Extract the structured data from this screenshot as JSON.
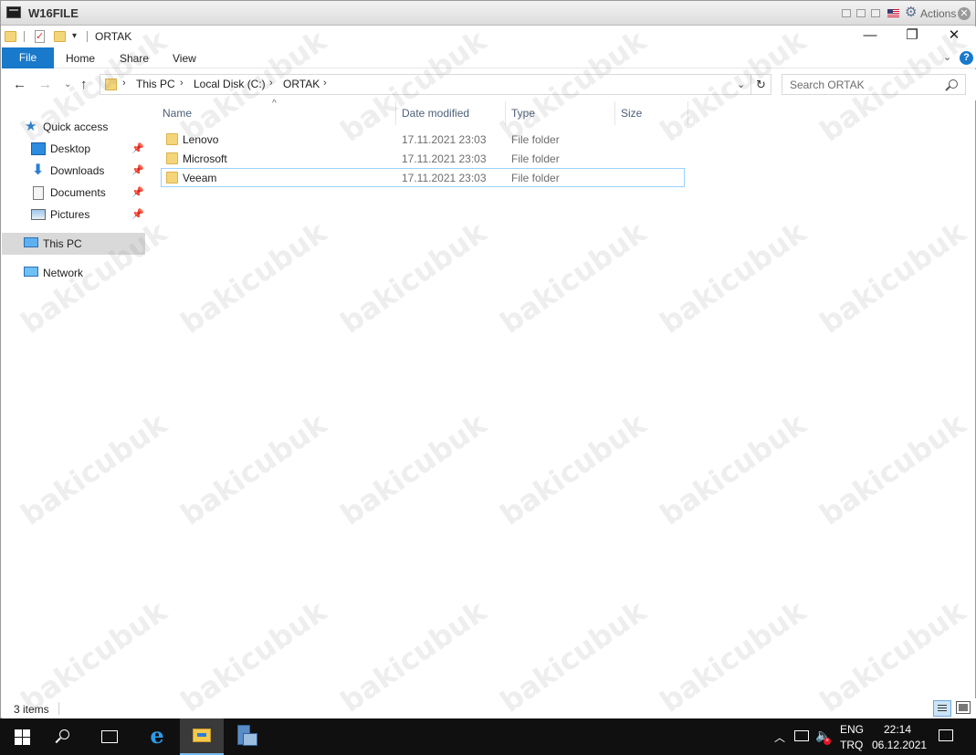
{
  "vm": {
    "title": "W16FILE",
    "actions_label": "Actions"
  },
  "window": {
    "title": "ORTAK",
    "min_glyph": "—",
    "restore_glyph": "❐",
    "close_glyph": "✕"
  },
  "ribbon": {
    "tabs": [
      "File",
      "Home",
      "Share",
      "View"
    ]
  },
  "address": {
    "crumbs": [
      "This PC",
      "Local Disk (C:)",
      "ORTAK"
    ]
  },
  "search": {
    "placeholder": "Search ORTAK"
  },
  "nav": {
    "items": [
      {
        "label": "Quick access",
        "icon": "star-icon"
      },
      {
        "label": "Desktop",
        "icon": "desktop-icon",
        "pinned": true
      },
      {
        "label": "Downloads",
        "icon": "download-icon",
        "pinned": true
      },
      {
        "label": "Documents",
        "icon": "documents-icon",
        "pinned": true
      },
      {
        "label": "Pictures",
        "icon": "pictures-icon",
        "pinned": true
      },
      {
        "label": "This PC",
        "icon": "computer-icon",
        "selected": true
      },
      {
        "label": "Network",
        "icon": "network-icon"
      }
    ]
  },
  "columns": {
    "name": "Name",
    "date": "Date modified",
    "type": "Type",
    "size": "Size"
  },
  "files": [
    {
      "name": "Lenovo",
      "date": "17.11.2021 23:03",
      "type": "File folder"
    },
    {
      "name": "Microsoft",
      "date": "17.11.2021 23:03",
      "type": "File folder"
    },
    {
      "name": "Veeam",
      "date": "17.11.2021 23:03",
      "type": "File folder",
      "selected": true
    }
  ],
  "status": {
    "item_count": "3 items"
  },
  "watermark": "bakicubuk",
  "taskbar": {
    "lang_line1": "ENG",
    "lang_line2": "TRQ",
    "time": "22:14",
    "date": "06.12.2021"
  },
  "colors": {
    "accent": "#1979ca",
    "folder": "#f5d57a",
    "selection_border": "#99d1ff",
    "taskbar": "#101010"
  }
}
